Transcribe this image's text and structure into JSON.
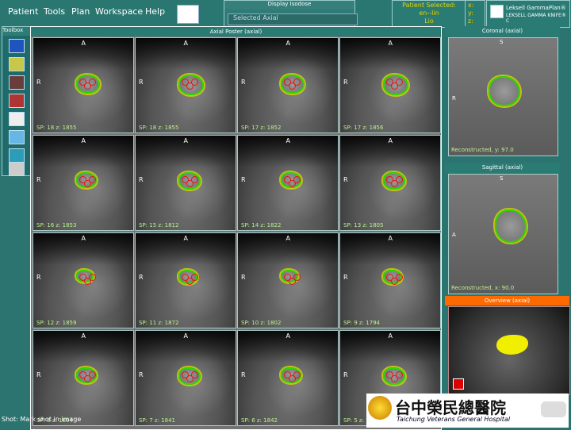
{
  "menus": [
    "Patient",
    "Tools",
    "Plan",
    "Workspace",
    "Help"
  ],
  "display_isodose": {
    "title": "Display Isodose",
    "line": "Selected   Axial"
  },
  "patient": {
    "label": "Patient Selected:",
    "name": "en--lin",
    "id": "Lio"
  },
  "coords": {
    "x": "x:",
    "y": "y:",
    "z": "z:"
  },
  "logo": {
    "line1": "Leksell GammaPlan®",
    "line2": "LEKSELL GAMMA KNIFE® C"
  },
  "toolbox": {
    "title": "Toolbox"
  },
  "axial": {
    "title": "Axial Poster (axial)"
  },
  "coronal": {
    "title": "Coronal (axial)",
    "footer": "Reconstructed, y: 97.0",
    "label_s": "S",
    "label_r": "R"
  },
  "sagittal": {
    "title": "Sagittal (axial)",
    "footer": "Reconstructed, x: 90.0",
    "label_s": "S",
    "label_a": "A"
  },
  "overview": {
    "title": "Overview (axial)"
  },
  "status": {
    "text": "Shot: Mark shot in image"
  },
  "hospital": {
    "cn": "台中榮民總醫院",
    "en": "Taichung Veterans General Hospital"
  },
  "grid_labels": [
    [
      "SP: 18 z: 1855",
      "SP: 18 z: 1855",
      "SP: 17 z: 1852",
      "SP: 17 z: 1856"
    ],
    [
      "SP: 16 z: 1853",
      "SP: 15 z: 1812",
      "SP: 14 z: 1822",
      "SP: 13 z: 1805"
    ],
    [
      "SP: 12 z: 1859",
      "SP: 11 z: 1872",
      "SP: 10 z: 1802",
      "SP:  9 z: 1794"
    ],
    [
      "SP:  8 z: 1894",
      "SP:  7 z: 1841",
      "SP:  6 z: 1842",
      "SP:  5 z: 1833"
    ]
  ],
  "colors": {
    "teal": "#2a7771",
    "tumor_outline": "#2fd600",
    "isodose": "#d6d600",
    "shot": "#e11111",
    "highlight": "#ffff00"
  }
}
